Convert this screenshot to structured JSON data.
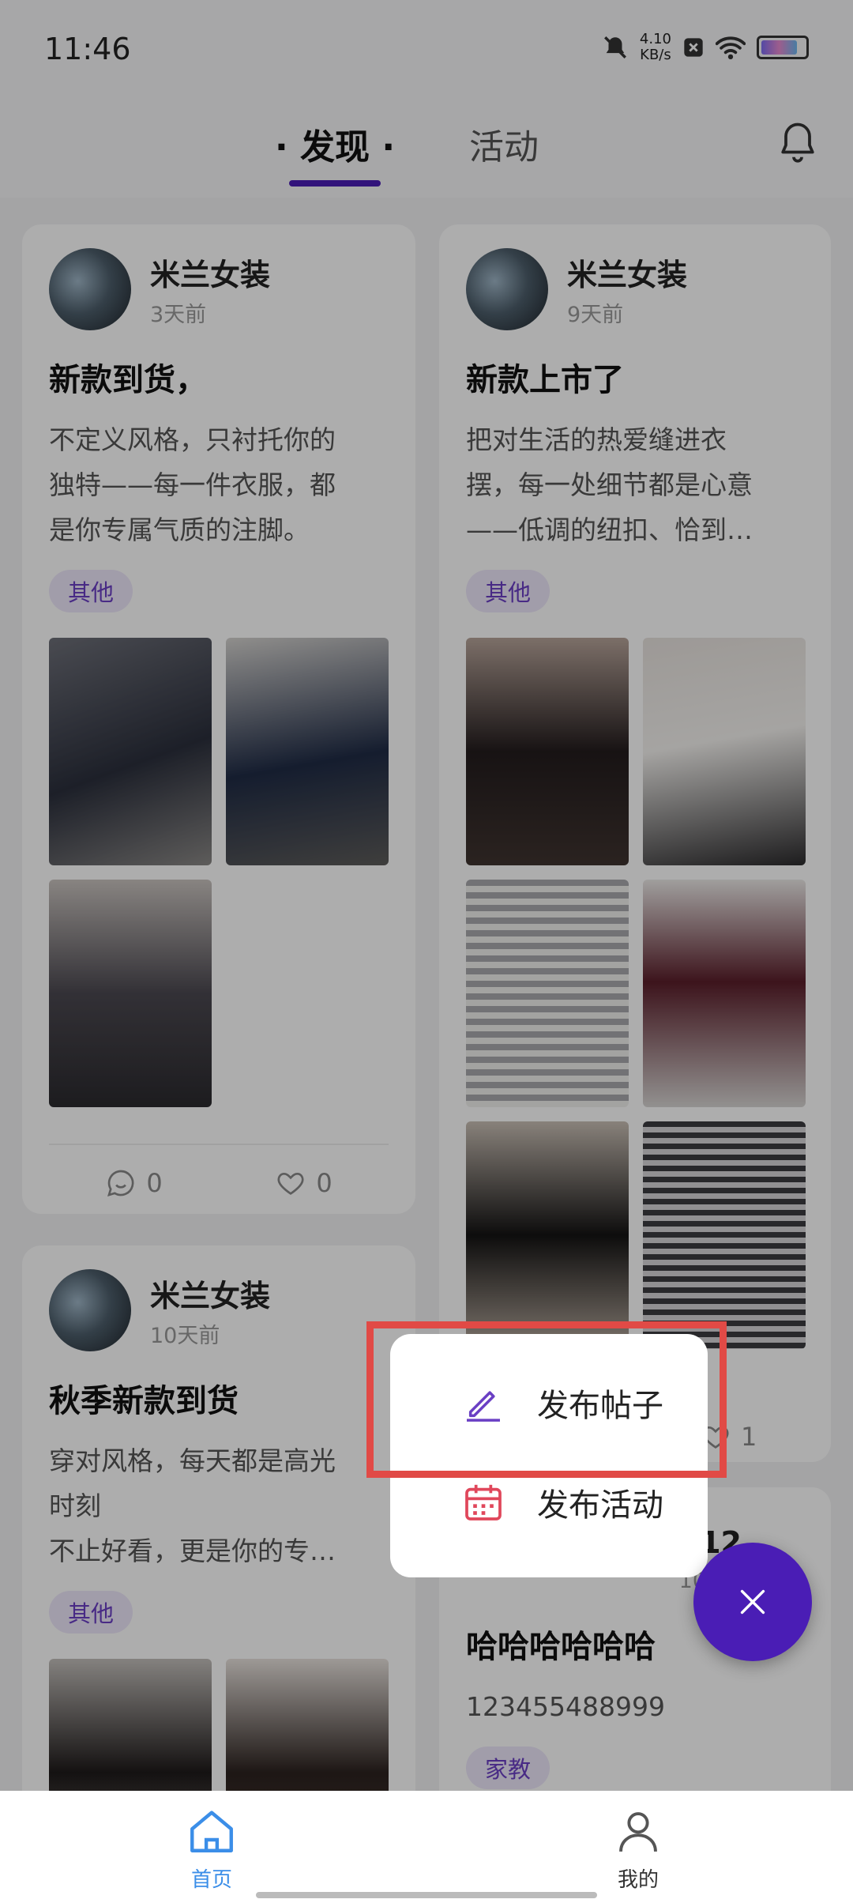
{
  "status_bar": {
    "time": "11:46",
    "speed_value": "4.10",
    "speed_unit": "KB/s",
    "battery_level": 0.85
  },
  "header": {
    "tab_discover": "· 发现 ·",
    "tab_activity": "活动"
  },
  "feed": {
    "cards": [
      {
        "author": "米兰女装",
        "time_ago": "3天前",
        "title": "新款到货，",
        "desc": "不定义风格，只衬托你的\n独特——每一件衣服，都\n是你专属气质的注脚。",
        "tag": "其他",
        "comments": "0",
        "likes": "0"
      },
      {
        "author": "米兰女装",
        "time_ago": "9天前",
        "title": "新款上市了",
        "desc": "把对生活的热爱缝进衣\n摆，每一处细节都是心意\n——低调的纽扣、恰到…",
        "tag": "其他",
        "likes": "1"
      },
      {
        "author": "米兰女装",
        "time_ago": "10天前",
        "title": "秋季新款到货",
        "desc": "穿对风格，每天都是高光\n时刻\n 不止好看，更是你的专…",
        "tag": "其他"
      },
      {
        "author_partial": "312",
        "time_ago_partial": "10天前",
        "title": "哈哈哈哈哈哈",
        "desc": "123455488999",
        "tag": "家教"
      }
    ]
  },
  "popup": {
    "post_label": "发布帖子",
    "event_label": "发布活动"
  },
  "bottom_nav": {
    "home_label": "首页",
    "me_label": "我的"
  },
  "colors": {
    "accent": "#4a1db5",
    "highlight": "#e14a46",
    "home_active": "#3b8ee8"
  }
}
